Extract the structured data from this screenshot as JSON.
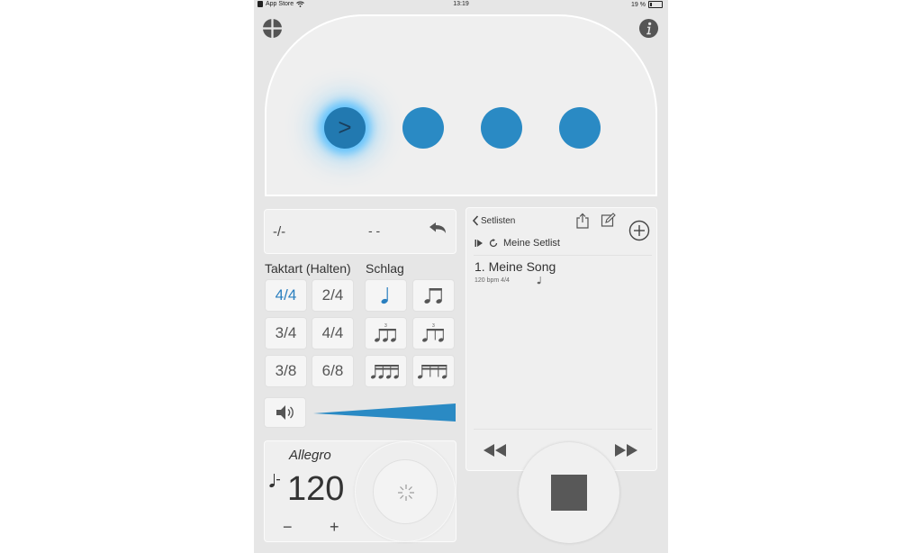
{
  "status_bar": {
    "carrier": "App Store",
    "time": "13:19",
    "battery": "19 %"
  },
  "beats": {
    "count": 4,
    "active_index": 0,
    "accent_symbol": ">"
  },
  "display": {
    "left_value": "-/-",
    "center_value": "- -"
  },
  "time_signature": {
    "title": "Taktart (Halten)",
    "options": [
      "4/4",
      "2/4",
      "3/4",
      "4/4",
      "3/8",
      "6/8"
    ],
    "selected_index": 0
  },
  "subdivision": {
    "title": "Schlag",
    "icons": [
      "quarter-note-icon",
      "eighth-notes-icon",
      "triplet-icon",
      "swing-triplet-icon",
      "sixteenth-notes-icon",
      "quintuplet-icon"
    ]
  },
  "volume": {
    "level": 1.0,
    "color": "#2a8ac4"
  },
  "tempo": {
    "marking": "Allegro",
    "bpm": "120",
    "minus": "−",
    "plus": "+"
  },
  "setlist": {
    "back_label": "Setlisten",
    "name": "Meine Setlist",
    "songs": [
      {
        "title": "1. Meine Song",
        "details": "120 bpm 4/4"
      }
    ]
  },
  "colors": {
    "accent": "#2a8ac4",
    "beat_active": "#2279b0",
    "background": "#e6e6e6"
  }
}
